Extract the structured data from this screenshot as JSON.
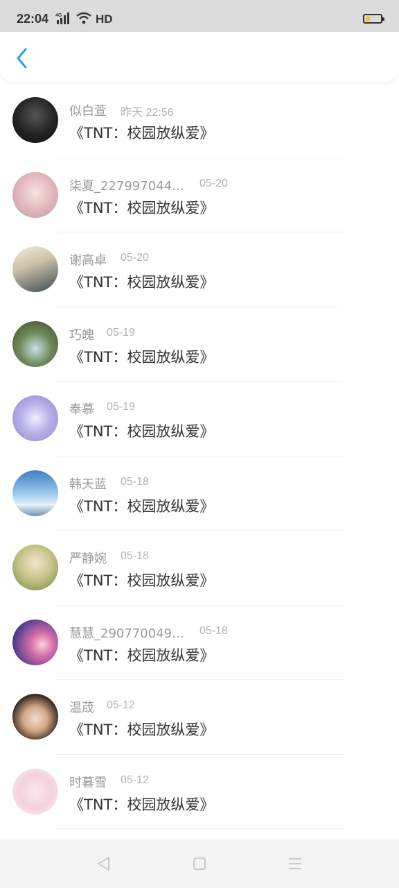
{
  "status_bar": {
    "time": "22:04",
    "signal_label": "4G",
    "hd_label": "HD",
    "battery_icon": "battery-low-icon"
  },
  "header": {
    "back_icon": "chevron-left-icon",
    "accent_color": "#2f9ee6"
  },
  "list": [
    {
      "name": "似白萱",
      "time": "昨天 22:56",
      "title": "《TNT：校园放纵爱》"
    },
    {
      "name": "柒夏_2279970449...",
      "time": "05-20",
      "title": "《TNT：校园放纵爱》"
    },
    {
      "name": "谢高卓",
      "time": "05-20",
      "title": "《TNT：校园放纵爱》"
    },
    {
      "name": "巧魄",
      "time": "05-19",
      "title": "《TNT：校园放纵爱》"
    },
    {
      "name": "奉慕",
      "time": "05-19",
      "title": "《TNT：校园放纵爱》"
    },
    {
      "name": "韩天蓝",
      "time": "05-18",
      "title": "《TNT：校园放纵爱》"
    },
    {
      "name": "严静婉",
      "time": "05-18",
      "title": "《TNT：校园放纵爱》"
    },
    {
      "name": "慧慧_2907700494...",
      "time": "05-18",
      "title": "《TNT：校园放纵爱》"
    },
    {
      "name": "温荿",
      "time": "05-12",
      "title": "《TNT：校园放纵爱》"
    },
    {
      "name": "时暮雪",
      "time": "05-12",
      "title": "《TNT：校园放纵爱》"
    }
  ],
  "nav_bar": {
    "back_icon": "triangle-back-icon",
    "home_icon": "square-home-icon",
    "menu_icon": "menu-lines-icon"
  }
}
